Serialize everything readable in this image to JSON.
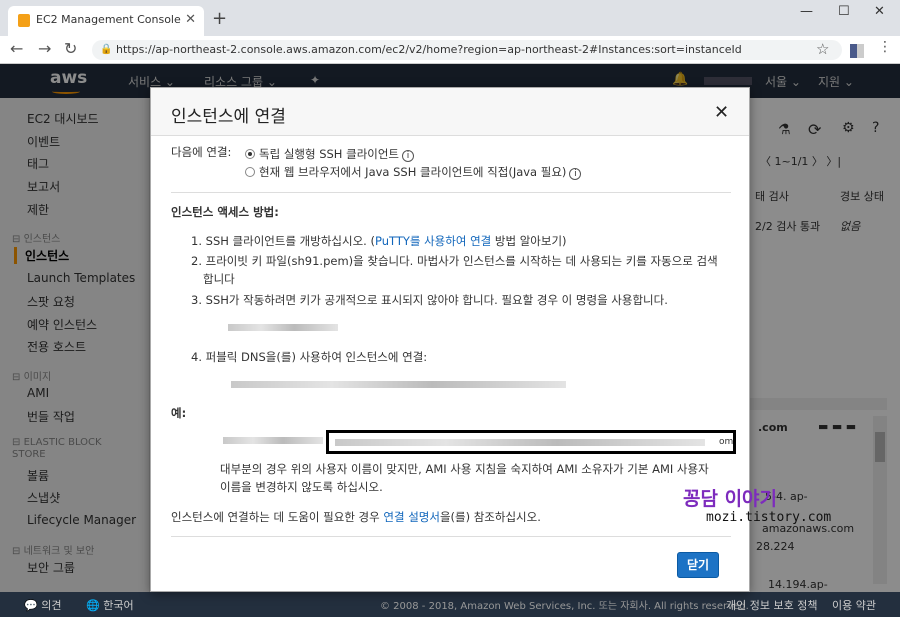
{
  "browser": {
    "tab_title": "EC2 Management Console",
    "url": "https://ap-northeast-2.console.aws.amazon.com/ec2/v2/home?region=ap-northeast-2#Instances:sort=instanceId"
  },
  "aws_header": {
    "logo": "aws",
    "services": "서비스 ⌄",
    "resource_groups": "리소스 그룹 ⌄",
    "region": "서울 ⌄",
    "support": "지원 ⌄"
  },
  "sidebar": {
    "items": [
      {
        "label": "EC2 대시보드"
      },
      {
        "label": "이벤트"
      },
      {
        "label": "태그"
      },
      {
        "label": "보고서"
      },
      {
        "label": "제한"
      },
      {
        "label": "인스턴스",
        "section": true
      },
      {
        "label": "인스턴스",
        "selected": true
      },
      {
        "label": "Launch Templates"
      },
      {
        "label": "스팟 요청"
      },
      {
        "label": "예약 인스턴스"
      },
      {
        "label": "전용 호스트"
      },
      {
        "label": "이미지",
        "section": true
      },
      {
        "label": "AMI"
      },
      {
        "label": "번들 작업"
      },
      {
        "label": "ELASTIC BLOCK STORE",
        "section": true
      },
      {
        "label": "볼륨"
      },
      {
        "label": "스냅샷"
      },
      {
        "label": "Lifecycle Manager"
      },
      {
        "label": "네트워크 및 보안",
        "section": true
      },
      {
        "label": "보안 그룹"
      }
    ]
  },
  "main": {
    "pager": "〈 1~1/1 〉 〉|",
    "col_status_check": "태 검사",
    "col_alarm": "경보 상태",
    "status_value": "2/2 검사 통과",
    "alarm_value": "없음",
    "dns_fragment": ".com",
    "dns_fragment2": "5-4. ap-",
    "dns_fragment3": "amazonaws.com",
    "ip_fragment": "28.224",
    "ip_fragment2": "14.194.ap-"
  },
  "modal": {
    "title": "인스턴스에 연결",
    "connect_label": "다음에 연결:",
    "option1": "독립 실행형 SSH 클라이언트",
    "option2": "현재 웹 브라우저에서 Java SSH 클라이언트에 직접(Java 필요)",
    "access_heading": "인스턴스 액세스 방법:",
    "step1_pre": "SSH 클라이언트를 개방하십시오. (",
    "step1_link": "PuTTY를 사용하여 연결",
    "step1_post": " 방법 알아보기)",
    "step2_line1": "프라이빗 키 파일(sh91.pem)을 찾습니다. 마법사가 인스턴스를 시작하는 데 사용되는 키를 자동으로 검색",
    "step2_line2": "합니다",
    "step3": "SSH가 작동하려면 키가 공개적으로 표시되지 않아야 합니다. 필요할 경우 이 명령을 사용합니다.",
    "step4": "퍼블릭 DNS을(를) 사용하여 인스턴스에 연결:",
    "example_label": "예:",
    "cmd_suffix": "om",
    "note_line1": "대부분의 경우 위의 사용자 이름이 맞지만, AMI 사용 지침을 숙지하여 AMI 소유자가 기본 AMI 사용자",
    "note_line2": "이름을 변경하지 않도록 하십시오.",
    "help_pre": "인스턴스에 연결하는 데 도움이 필요한 경우 ",
    "help_link": "연결 설명서",
    "help_post": "을(를) 참조하십시오.",
    "close_button": "닫기"
  },
  "footer": {
    "feedback": "의견",
    "language": "한국어",
    "copyright": "© 2008 - 2018, Amazon Web Services, Inc. 또는 자회사. All rights reserved.",
    "privacy": "개인 정보 보호 정책",
    "terms": "이용 약관"
  },
  "watermark": {
    "line1": "꽁담 이야기",
    "line2": "mozi.tistory.com"
  }
}
